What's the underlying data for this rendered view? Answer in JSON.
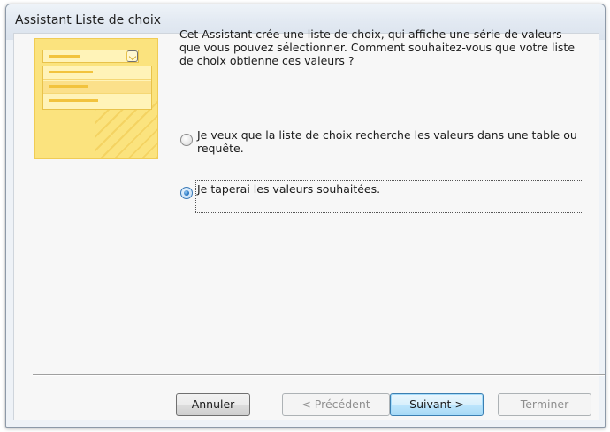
{
  "window": {
    "title": "Assistant Liste de choix"
  },
  "intro_text": "Cet Assistant crée une liste de choix, qui affiche une série de valeurs que vous pouvez sélectionner. Comment souhaitez-vous que votre liste de choix obtienne ces valeurs ?",
  "options": [
    {
      "label": "Je veux que la liste de choix recherche les valeurs dans une table ou requête.",
      "selected": false
    },
    {
      "label": "Je taperai les valeurs souhaitées.",
      "selected": true
    }
  ],
  "buttons": {
    "cancel": "Annuler",
    "previous": "< Précédent",
    "next": "Suivant >",
    "finish": "Terminer"
  },
  "button_states": {
    "previous_enabled": false,
    "finish_enabled": false,
    "default_button": "next"
  },
  "colors": {
    "illustration": "#fbe37e",
    "radio_selected": "#1e6fbd",
    "default_button_border": "#3c7fb1"
  }
}
